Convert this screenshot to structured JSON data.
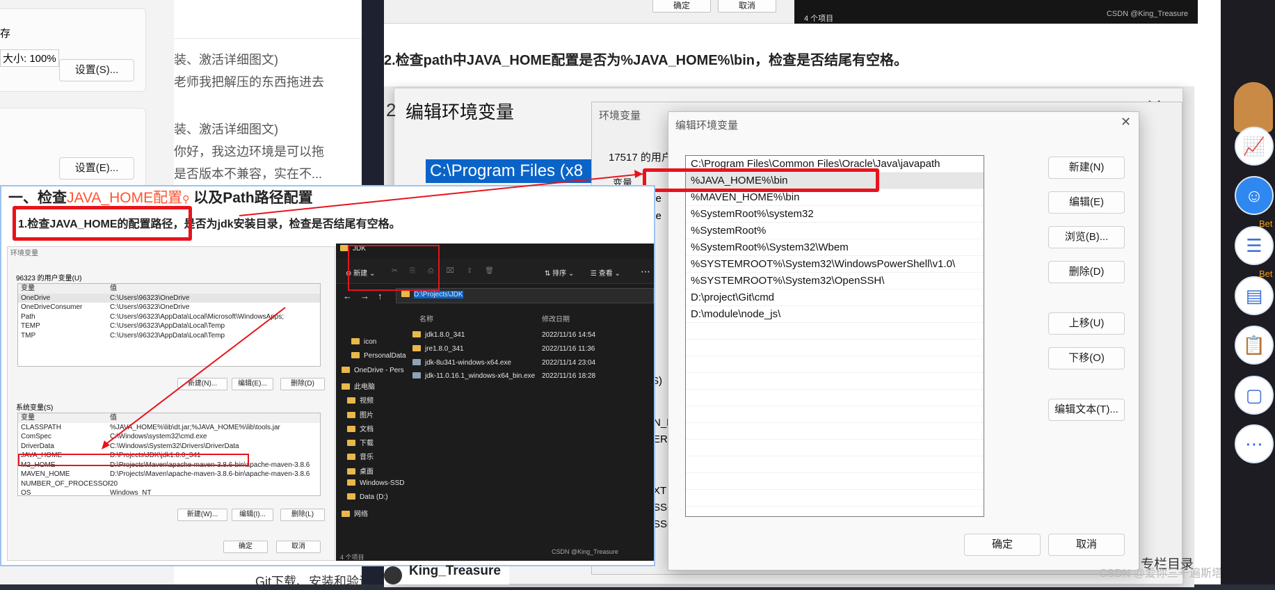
{
  "left_settings": {
    "text1": "存",
    "text2": "大小: 100%",
    "btn1": "设置(S)...",
    "btn2": "设置(E)..."
  },
  "blog": {
    "line1": "装、激活详细图文)",
    "line2": "老师我把解压的东西拖进去",
    "line3": "装、激活详细图文)",
    "line4": "你好，我这边环境是可以拖",
    "line5": "是否版本不兼容，实在不...",
    "bottom": "Git下载、安装和验证"
  },
  "top_snippet": {
    "ok": "确定",
    "cancel": "取消",
    "items": "4 个项目",
    "credit": "CSDN @King_Treasure"
  },
  "article": {
    "step2": "2.检查path中JAVA_HOME配置是否为%JAVA_HOME%\\bin，检查是否结尾有空格。",
    "bottom_author": "King_Treasure",
    "column_dir": "专栏目录",
    "watermark": "CSDN @爱你三千遍斯塔克"
  },
  "big_dialog": {
    "title": "编辑环境变量",
    "close": "✕",
    "selected_path": "C:\\Program Files (x8",
    "number_label": "2"
  },
  "env_dialog": {
    "title": "环境变量",
    "user_label": "17517 的用户",
    "var_label": "变量",
    "frag1": "ve",
    "frag2": "ve",
    "frag3": "S)",
    "frag4": "N_H",
    "frag5": "ER_",
    "frag6": "XT",
    "frag7": "SSO",
    "frag8": "SSO"
  },
  "path_dialog": {
    "title": "编辑环境变量",
    "close": "✕",
    "entries": [
      "C:\\Program Files\\Common Files\\Oracle\\Java\\javapath",
      "%JAVA_HOME%\\bin",
      "%MAVEN_HOME%\\bin",
      "%SystemRoot%\\system32",
      "%SystemRoot%",
      "%SystemRoot%\\System32\\Wbem",
      "%SYSTEMROOT%\\System32\\WindowsPowerShell\\v1.0\\",
      "%SYSTEMROOT%\\System32\\OpenSSH\\",
      "D:\\project\\Git\\cmd",
      "D:\\module\\node_js\\"
    ],
    "buttons": {
      "new": "新建(N)",
      "edit": "编辑(E)",
      "browse": "浏览(B)...",
      "delete": "删除(D)",
      "up": "上移(U)",
      "down": "下移(O)",
      "edit_text": "编辑文本(T)...",
      "ok": "确定",
      "cancel": "取消"
    }
  },
  "overlay": {
    "heading_prefix": "一、检查",
    "heading_link": "JAVA_HOME配置",
    "heading_suffix": "以及Path路径配置",
    "step1_prefix": "1.检查JAVA_HOME的配置路径，",
    "step1_suffix": "是否为jdk安装目录，检查是否结尾有空格。",
    "env_title": "环境变量",
    "user_vars_label": "96323 的用户变量(U)",
    "col_var": "变量",
    "col_val": "值",
    "user_vars": [
      [
        "OneDrive",
        "C:\\Users\\96323\\OneDrive"
      ],
      [
        "OneDriveConsumer",
        "C:\\Users\\96323\\OneDrive"
      ],
      [
        "Path",
        "C:\\Users\\96323\\AppData\\Local\\Microsoft\\WindowsApps;"
      ],
      [
        "TEMP",
        "C:\\Users\\96323\\AppData\\Local\\Temp"
      ],
      [
        "TMP",
        "C:\\Users\\96323\\AppData\\Local\\Temp"
      ]
    ],
    "sys_vars_label": "系统变量(S)",
    "sys_vars": [
      [
        "CLASSPATH",
        "%JAVA_HOME%\\lib\\dt.jar;%JAVA_HOME%\\lib\\tools.jar"
      ],
      [
        "ComSpec",
        "C:\\Windows\\system32\\cmd.exe"
      ],
      [
        "DriverData",
        "C:\\Windows\\System32\\Drivers\\DriverData"
      ],
      [
        "JAVA_HOME",
        "D:\\Projects\\JDK\\jdk1.8.0_341"
      ],
      [
        "M2_HOME",
        "D:\\Projects\\Maven\\apache-maven-3.8.6-bin\\apache-maven-3.8.6"
      ],
      [
        "MAVEN_HOME",
        "D:\\Projects\\Maven\\apache-maven-3.8.6-bin\\apache-maven-3.8.6"
      ],
      [
        "NUMBER_OF_PROCESSORS",
        "20"
      ],
      [
        "OS",
        "Windows_NT"
      ]
    ],
    "btn_new_u": "新建(N)...",
    "btn_edit_u": "编辑(E)...",
    "btn_del_u": "删除(D)",
    "btn_new_s": "新建(W)...",
    "btn_edit_s": "编辑(I)...",
    "btn_del_s": "删除(L)",
    "btn_ok": "确定",
    "btn_cancel": "取消"
  },
  "explorer": {
    "title": "JDK",
    "new": "新建",
    "sort": "排序",
    "view": "查看",
    "address": "D:\\Projects\\JDK",
    "col_name": "名称",
    "col_date": "修改日期",
    "nav": [
      "icon",
      "PersonalData",
      "OneDrive - Pers",
      "此电脑",
      "视频",
      "图片",
      "文档",
      "下载",
      "音乐",
      "桌面",
      "Windows-SSD",
      "Data (D:)",
      "网络"
    ],
    "files": [
      {
        "name": "jdk1.8.0_341",
        "date": "2022/11/16 14:54",
        "type": "folder"
      },
      {
        "name": "jre1.8.0_341",
        "date": "2022/11/16 11:36",
        "type": "folder"
      },
      {
        "name": "jdk-8u341-windows-x64.exe",
        "date": "2022/11/14 23:04",
        "type": "exe"
      },
      {
        "name": "jdk-11.0.16.1_windows-x64_bin.exe",
        "date": "2022/11/16 18:28",
        "type": "exe"
      }
    ],
    "items": "4 个项目",
    "credit": "CSDN @King_Treasure"
  },
  "right_side": {
    "badge1": "Bet",
    "badge2": "Bet"
  },
  "colors": {
    "red": "#e8131c",
    "link_red": "#fc5531",
    "selection_blue": "#0a64c8",
    "title_blue": "#1a73e8"
  }
}
